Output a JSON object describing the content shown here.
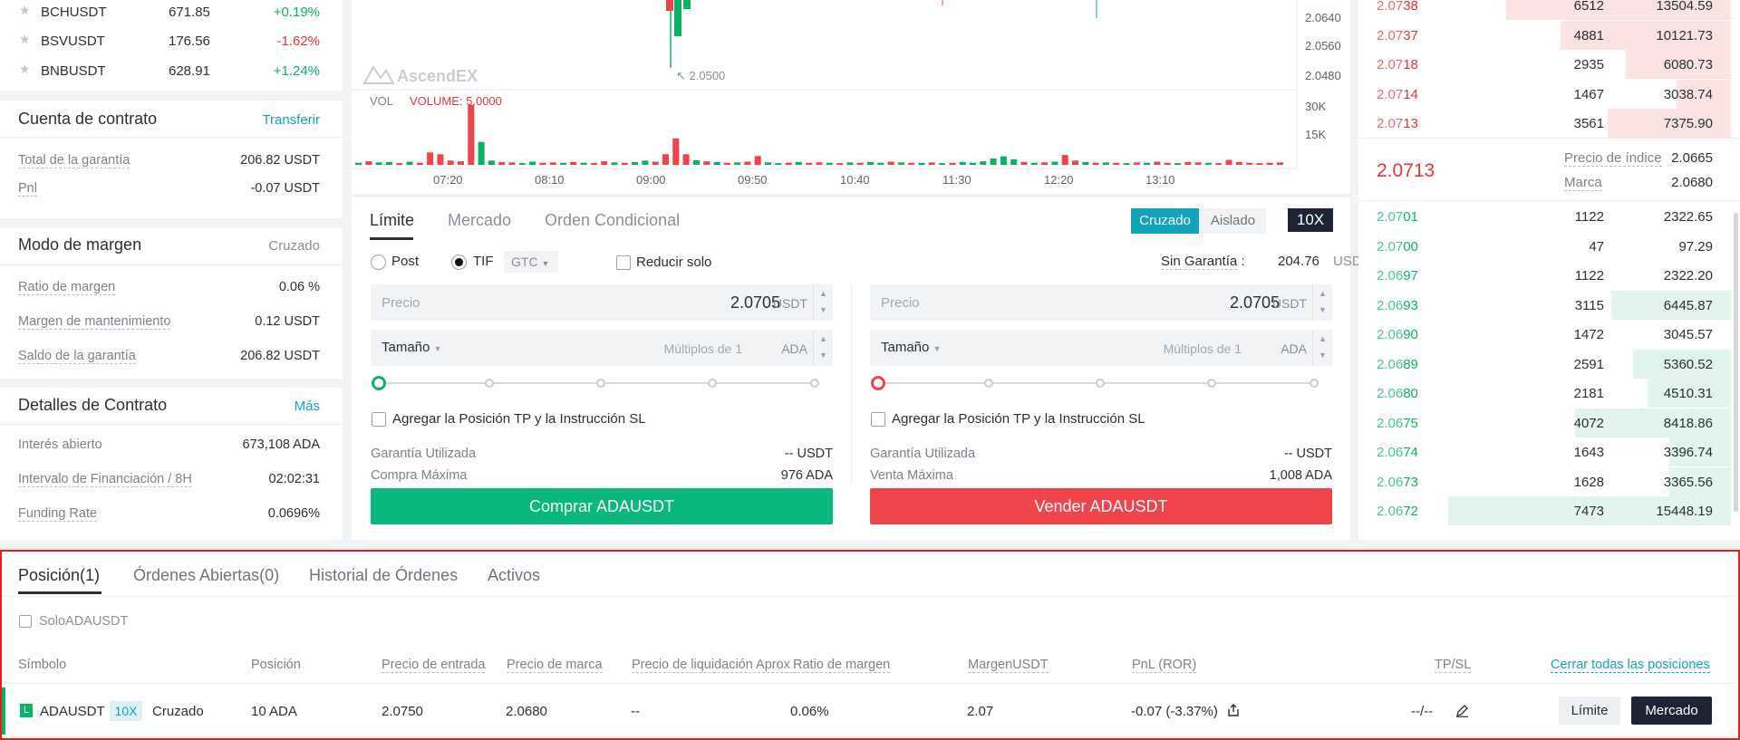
{
  "tickers": [
    {
      "symbol": "BCHUSDT",
      "price": "671.85",
      "change": "+0.19%",
      "dir": "up"
    },
    {
      "symbol": "BSVUSDT",
      "price": "176.56",
      "change": "-1.62%",
      "dir": "down"
    },
    {
      "symbol": "BNBUSDT",
      "price": "628.91",
      "change": "+1.24%",
      "dir": "up"
    }
  ],
  "contract_account": {
    "title": "Cuenta de contrato",
    "link": "Transferir",
    "rows": [
      {
        "label": "Total de la garantía",
        "value": "206.82 USDT"
      },
      {
        "label": "Pnl",
        "value": "-0.07 USDT"
      }
    ]
  },
  "margin_mode": {
    "title": "Modo de margen",
    "value": "Cruzado",
    "rows": [
      {
        "label": "Ratio de margen",
        "value": "0.06 %"
      },
      {
        "label": "Margen de mantenimiento",
        "value": "0.12 USDT"
      },
      {
        "label": "Saldo de la garantía",
        "value": "206.82 USDT"
      }
    ]
  },
  "contract_details": {
    "title": "Detalles de Contrato",
    "link": "Más",
    "rows": [
      {
        "label": "Interés abierto",
        "value": "673,108 ADA"
      },
      {
        "label": "Intervalo de Financiación / 8H",
        "value": "02:02:31"
      },
      {
        "label": "Funding Rate",
        "value": "0.0696%"
      }
    ]
  },
  "chart": {
    "watermark": "AscendEX",
    "low_marker": "2.0500",
    "price_ticks": [
      "2.0640",
      "2.0560",
      "2.0480"
    ],
    "vol_label": "VOL",
    "volume_label": "VOLUME: 5.0000",
    "vol_ticks": [
      "30K",
      "15K"
    ],
    "time_ticks": [
      "07:20",
      "08:10",
      "09:00",
      "09:50",
      "10:40",
      "11:30",
      "12:20",
      "13:10"
    ],
    "colors": {
      "up": "#0ab364",
      "down": "#f0434a"
    },
    "volume_bars": [
      {
        "v": 0.6,
        "d": "up"
      },
      {
        "v": 1.0,
        "d": "down"
      },
      {
        "v": 0.7,
        "d": "up"
      },
      {
        "v": 0.8,
        "d": "up"
      },
      {
        "v": 0.5,
        "d": "down"
      },
      {
        "v": 0.9,
        "d": "up"
      },
      {
        "v": 0.6,
        "d": "down"
      },
      {
        "v": 3.5,
        "d": "down"
      },
      {
        "v": 3.0,
        "d": "down"
      },
      {
        "v": 1.2,
        "d": "down"
      },
      {
        "v": 1.0,
        "d": "down"
      },
      {
        "v": 17.0,
        "d": "down"
      },
      {
        "v": 6.5,
        "d": "up"
      },
      {
        "v": 1.2,
        "d": "up"
      },
      {
        "v": 0.8,
        "d": "down"
      },
      {
        "v": 0.7,
        "d": "down"
      },
      {
        "v": 0.5,
        "d": "up"
      },
      {
        "v": 0.9,
        "d": "up"
      },
      {
        "v": 0.6,
        "d": "down"
      },
      {
        "v": 0.7,
        "d": "down"
      },
      {
        "v": 0.6,
        "d": "up"
      },
      {
        "v": 0.8,
        "d": "down"
      },
      {
        "v": 0.6,
        "d": "up"
      },
      {
        "v": 0.5,
        "d": "down"
      },
      {
        "v": 1.0,
        "d": "down"
      },
      {
        "v": 0.7,
        "d": "up"
      },
      {
        "v": 0.6,
        "d": "down"
      },
      {
        "v": 0.8,
        "d": "up"
      },
      {
        "v": 1.2,
        "d": "up"
      },
      {
        "v": 0.9,
        "d": "down"
      },
      {
        "v": 3.0,
        "d": "down"
      },
      {
        "v": 7.5,
        "d": "down"
      },
      {
        "v": 3.0,
        "d": "down"
      },
      {
        "v": 1.3,
        "d": "up"
      },
      {
        "v": 1.0,
        "d": "down"
      },
      {
        "v": 0.8,
        "d": "up"
      },
      {
        "v": 0.6,
        "d": "down"
      },
      {
        "v": 0.7,
        "d": "up"
      },
      {
        "v": 0.9,
        "d": "down"
      },
      {
        "v": 2.5,
        "d": "down"
      },
      {
        "v": 0.7,
        "d": "up"
      },
      {
        "v": 0.5,
        "d": "up"
      },
      {
        "v": 0.6,
        "d": "down"
      },
      {
        "v": 0.8,
        "d": "up"
      },
      {
        "v": 0.6,
        "d": "down"
      },
      {
        "v": 0.7,
        "d": "down"
      },
      {
        "v": 0.6,
        "d": "up"
      },
      {
        "v": 0.5,
        "d": "down"
      },
      {
        "v": 0.7,
        "d": "up"
      },
      {
        "v": 0.6,
        "d": "down"
      },
      {
        "v": 0.8,
        "d": "up"
      },
      {
        "v": 0.6,
        "d": "up"
      },
      {
        "v": 0.9,
        "d": "down"
      },
      {
        "v": 0.7,
        "d": "up"
      },
      {
        "v": 0.6,
        "d": "down"
      },
      {
        "v": 0.6,
        "d": "up"
      },
      {
        "v": 0.7,
        "d": "down"
      },
      {
        "v": 0.5,
        "d": "up"
      },
      {
        "v": 0.6,
        "d": "down"
      },
      {
        "v": 0.8,
        "d": "up"
      },
      {
        "v": 0.6,
        "d": "up"
      },
      {
        "v": 1.0,
        "d": "up"
      },
      {
        "v": 1.8,
        "d": "up"
      },
      {
        "v": 2.4,
        "d": "up"
      },
      {
        "v": 1.6,
        "d": "up"
      },
      {
        "v": 0.8,
        "d": "down"
      },
      {
        "v": 0.6,
        "d": "up"
      },
      {
        "v": 0.7,
        "d": "down"
      },
      {
        "v": 0.9,
        "d": "up"
      },
      {
        "v": 2.8,
        "d": "down"
      },
      {
        "v": 1.2,
        "d": "down"
      },
      {
        "v": 0.8,
        "d": "up"
      },
      {
        "v": 0.6,
        "d": "down"
      },
      {
        "v": 0.7,
        "d": "up"
      },
      {
        "v": 0.6,
        "d": "down"
      },
      {
        "v": 0.5,
        "d": "up"
      },
      {
        "v": 0.7,
        "d": "down"
      },
      {
        "v": 0.6,
        "d": "up"
      },
      {
        "v": 0.9,
        "d": "down"
      },
      {
        "v": 0.6,
        "d": "down"
      },
      {
        "v": 0.5,
        "d": "up"
      },
      {
        "v": 0.8,
        "d": "down"
      },
      {
        "v": 0.7,
        "d": "down"
      },
      {
        "v": 0.6,
        "d": "up"
      },
      {
        "v": 0.5,
        "d": "down"
      },
      {
        "v": 1.4,
        "d": "down"
      },
      {
        "v": 0.8,
        "d": "down"
      },
      {
        "v": 0.6,
        "d": "down"
      },
      {
        "v": 0.5,
        "d": "down"
      },
      {
        "v": 0.6,
        "d": "down"
      },
      {
        "v": 0.7,
        "d": "down"
      }
    ]
  },
  "order_form": {
    "tabs": [
      "Límite",
      "Mercado",
      "Orden Condicional"
    ],
    "mode_cross": "Cruzado",
    "mode_isolated": "Aislado",
    "leverage": "10X",
    "post": "Post",
    "tif": "TIF",
    "gtc": "GTC",
    "reduce_only": "Reducir solo",
    "available_label": "Sin Garantía",
    "available_value": "204.76",
    "available_unit": "USDT",
    "buy": {
      "price_placeholder": "Precio",
      "price": "2.0705",
      "price_unit": "USDT",
      "size_label": "Tamaño",
      "size_placeholder": "Múltiplos de 1",
      "size_unit": "ADA",
      "tpsl": "Agregar la Posición TP y la Instrucción SL",
      "margin_label": "Garantía Utilizada",
      "margin_value": "-- USDT",
      "max_label": "Compra Máxima",
      "max_value": "976 ADA",
      "button": "Comprar ADAUSDT"
    },
    "sell": {
      "price_placeholder": "Precio",
      "price": "2.0705",
      "price_unit": "USDT",
      "size_label": "Tamaño",
      "size_placeholder": "Múltiplos de 1",
      "size_unit": "ADA",
      "tpsl": "Agregar la Posición TP y la Instrucción SL",
      "margin_label": "Garantía Utilizada",
      "margin_value": "-- USDT",
      "max_label": "Venta Máxima",
      "max_value": "1,008 ADA",
      "button": "Vender ADAUSDT"
    }
  },
  "order_book": {
    "asks": [
      {
        "p_head": "2.07",
        "p_tail": "38",
        "qty": "6512",
        "total": "13504.59",
        "depth": 0.62
      },
      {
        "p_head": "2.07",
        "p_tail": "37",
        "qty": "4881",
        "total": "10121.73",
        "depth": 0.47
      },
      {
        "p_head": "2.07",
        "p_tail": "18",
        "qty": "2935",
        "total": "6080.73",
        "depth": 0.29
      },
      {
        "p_head": "2.07",
        "p_tail": "14",
        "qty": "1467",
        "total": "3038.74",
        "depth": 0.15
      },
      {
        "p_head": "2.07",
        "p_tail": "13",
        "qty": "3561",
        "total": "7375.90",
        "depth": 0.34
      }
    ],
    "last_price": "2.0713",
    "index_label": "Precio de índice",
    "index_value": "2.0665",
    "mark_label": "Marca",
    "mark_value": "2.0680",
    "bids": [
      {
        "p_head": "2.07",
        "p_tail": "01",
        "qty": "1122",
        "total": "2322.65",
        "depth": 0.0
      },
      {
        "p_head": "2.07",
        "p_tail": "00",
        "qty": "47",
        "total": "97.29",
        "depth": 0.0
      },
      {
        "p_head": "2.06",
        "p_tail": "97",
        "qty": "1122",
        "total": "2322.20",
        "depth": 0.0
      },
      {
        "p_head": "2.06",
        "p_tail": "93",
        "qty": "3115",
        "total": "6445.87",
        "depth": 0.33
      },
      {
        "p_head": "2.06",
        "p_tail": "90",
        "qty": "1472",
        "total": "3045.57",
        "depth": 0.0
      },
      {
        "p_head": "2.06",
        "p_tail": "89",
        "qty": "2591",
        "total": "5360.52",
        "depth": 0.27
      },
      {
        "p_head": "2.06",
        "p_tail": "80",
        "qty": "2181",
        "total": "4510.31",
        "depth": 0.23
      },
      {
        "p_head": "2.06",
        "p_tail": "75",
        "qty": "4072",
        "total": "8418.86",
        "depth": 0.43
      },
      {
        "p_head": "2.06",
        "p_tail": "74",
        "qty": "1643",
        "total": "3396.74",
        "depth": 0.17
      },
      {
        "p_head": "2.06",
        "p_tail": "73",
        "qty": "1628",
        "total": "3365.56",
        "depth": 0.17
      },
      {
        "p_head": "2.06",
        "p_tail": "72",
        "qty": "7473",
        "total": "15448.19",
        "depth": 0.78
      }
    ]
  },
  "positions": {
    "tabs": [
      "Posición(1)",
      "Órdenes Abiertas(0)",
      "Historial de Órdenes",
      "Activos"
    ],
    "filter": "SoloADAUSDT",
    "headers": {
      "symbol": "Símbolo",
      "position": "Posición",
      "entry": "Precio de entrada",
      "mark": "Precio de marca",
      "liq": "Precio de liquidación Aprox",
      "margin_ratio": "Ratio de margen",
      "margin": "MargenUSDT",
      "pnl": "PnL (ROR)",
      "tpsl": "TP/SL",
      "close_all": "Cerrar todas las posiciones"
    },
    "row": {
      "side": "L",
      "symbol": "ADAUSDT",
      "leverage": "10X",
      "mode": "Cruzado",
      "position": "10 ADA",
      "entry": "2.0750",
      "mark": "2.0680",
      "liq": "--",
      "margin_ratio": "0.06%",
      "margin": "2.07",
      "pnl": "-0.07 (-3.37%)",
      "tpsl": "--/--",
      "btn_limit": "Límite",
      "btn_market": "Mercado"
    }
  }
}
